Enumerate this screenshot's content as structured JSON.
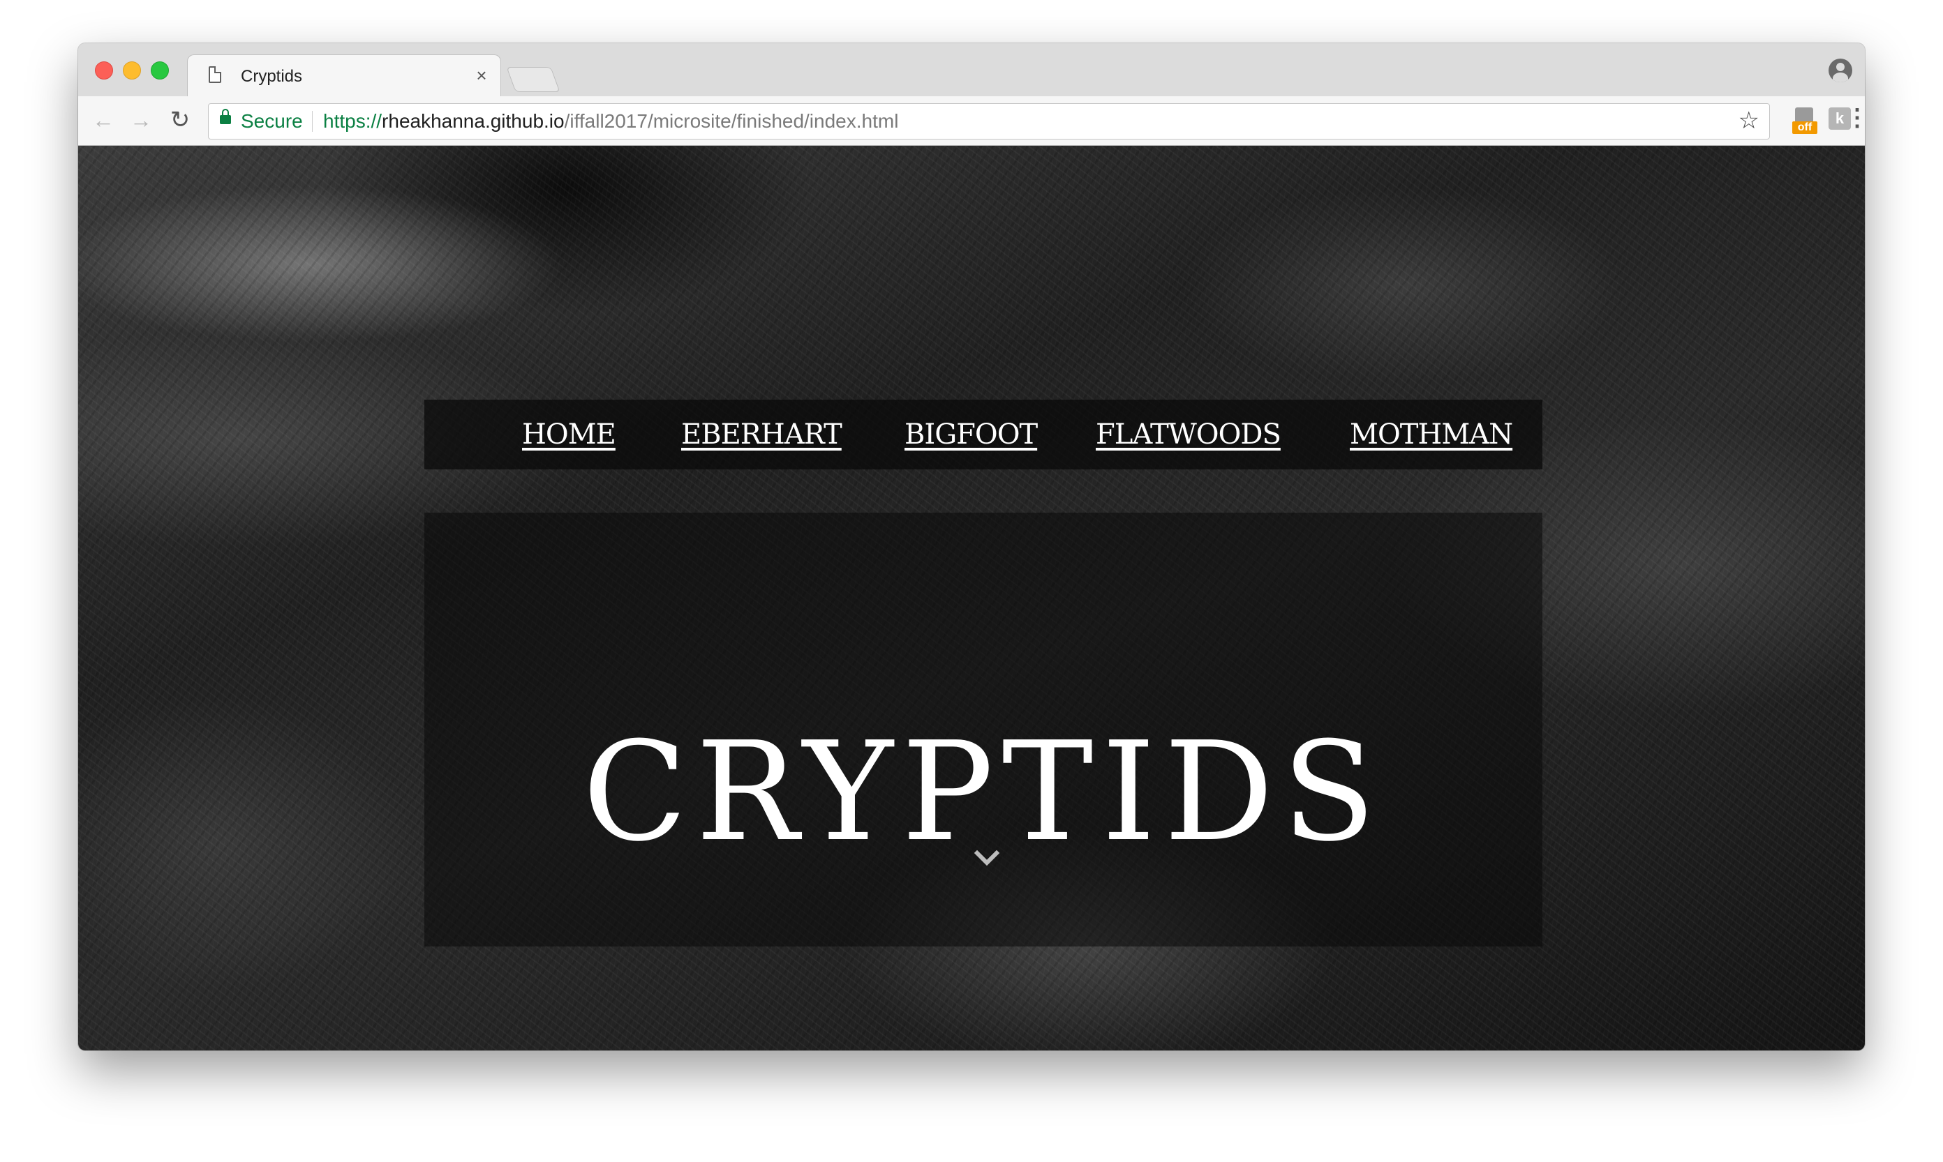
{
  "browser": {
    "tab": {
      "title": "Cryptids",
      "close_label": "×"
    },
    "toolbar": {
      "back_icon": "←",
      "forward_icon": "→",
      "reload_icon": "↻",
      "secure_label": "Secure",
      "url_scheme": "https://",
      "url_host": "rheakhanna.github.io",
      "url_path": "/iffall2017/microsite/finished/index.html",
      "star_icon": "☆",
      "extension_badge": "off",
      "extension_letter": "k",
      "menu_icon": "⋮"
    },
    "colors": {
      "secure_green": "#0b8043",
      "close_red": "#fc5f57",
      "minimize_yellow": "#fdbc2e",
      "zoom_green": "#28c840"
    }
  },
  "page": {
    "nav": [
      {
        "label": "HOME"
      },
      {
        "label": "EBERHART"
      },
      {
        "label": "BIGFOOT"
      },
      {
        "label": "FLATWOODS"
      },
      {
        "label": "MOTHMAN"
      }
    ],
    "hero": {
      "title": "CRYPTIDS",
      "scroll_icon": "chevron-down-icon"
    }
  }
}
